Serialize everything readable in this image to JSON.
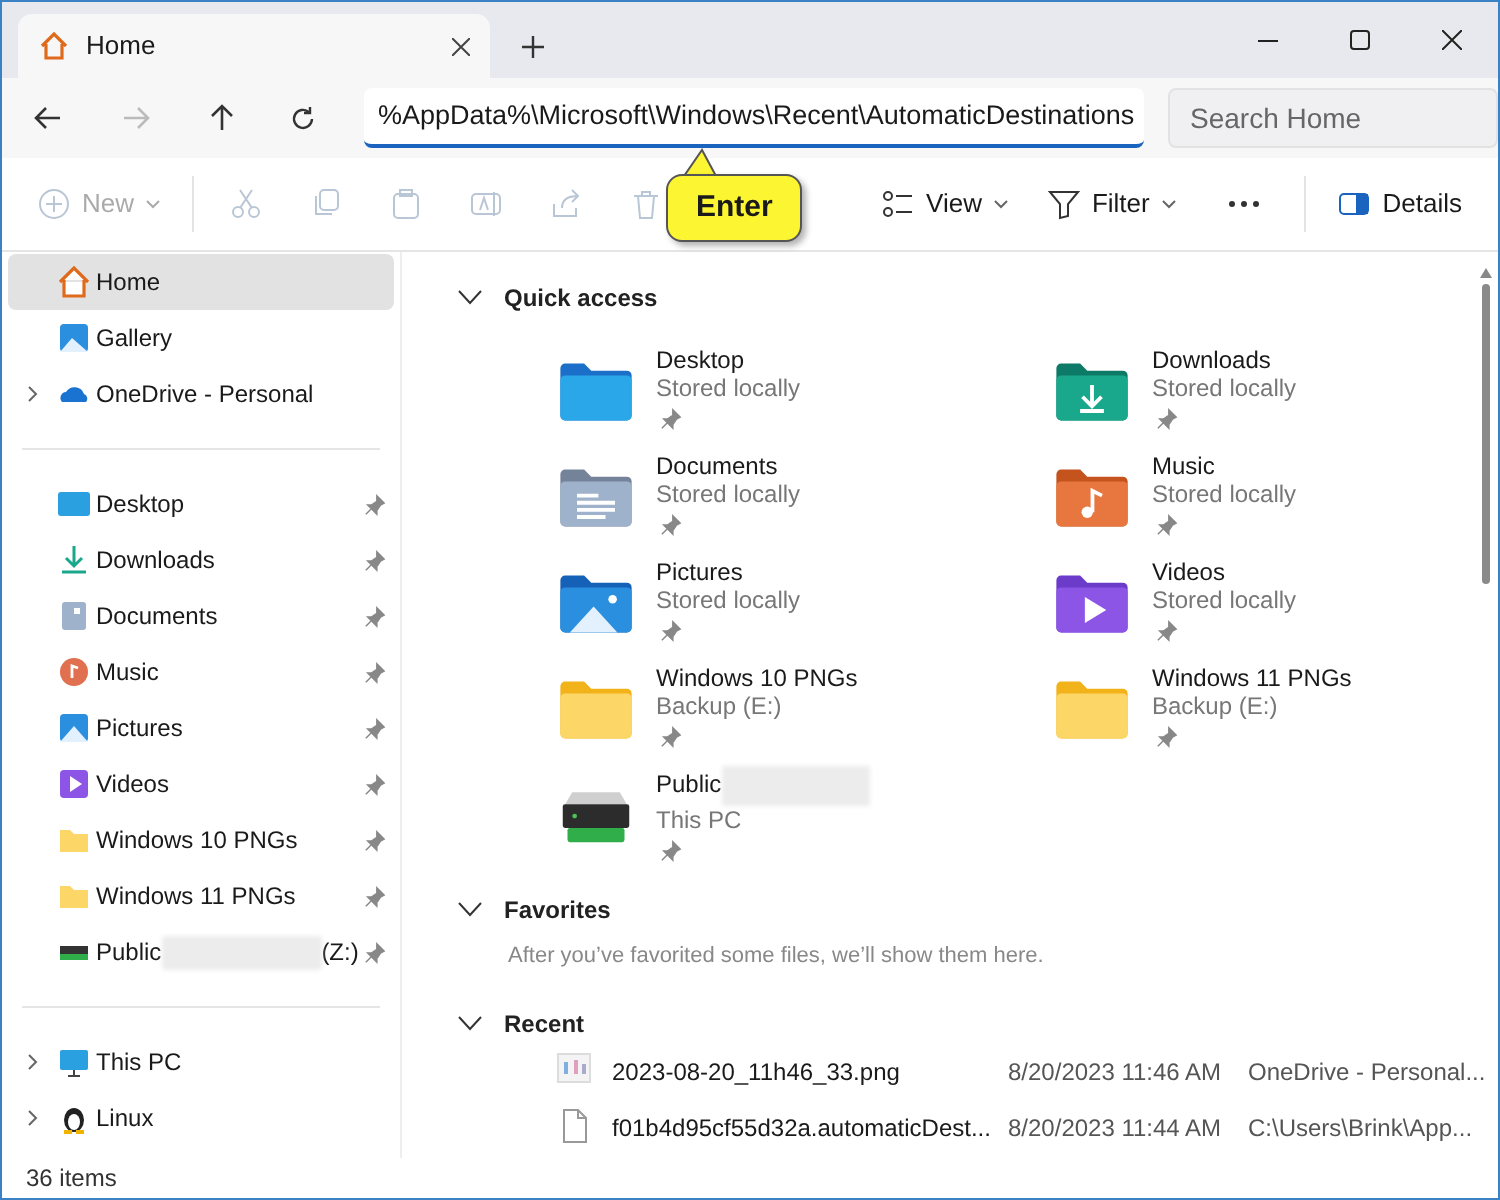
{
  "tabs": [
    {
      "label": "Home",
      "selected": true
    }
  ],
  "address": {
    "value": "%AppData%\\Microsoft\\Windows\\Recent\\AutomaticDestinations"
  },
  "search": {
    "placeholder": "Search Home"
  },
  "toolbar": [
    {
      "label": "New",
      "disabled": true
    },
    {
      "disabled": true
    },
    {
      "disabled": true
    },
    {
      "disabled": true
    },
    {
      "disabled": true
    },
    {
      "disabled": true
    },
    {
      "disabled": true
    },
    {
      "label": "View",
      "disabled": false
    },
    {
      "label": "Filter",
      "disabled": false
    },
    {
      "disabled": false
    },
    {
      "label": "Details",
      "disabled": false
    }
  ],
  "callout": {
    "text": "Enter"
  },
  "sidebar": {
    "groups": [
      {
        "items": [
          {
            "label": "Home",
            "selected": true,
            "has_children": false,
            "pinned": false
          },
          {
            "label": "Gallery",
            "selected": false,
            "has_children": false,
            "pinned": false
          },
          {
            "label": "OneDrive - Personal",
            "selected": false,
            "has_children": true,
            "pinned": false
          }
        ]
      },
      {
        "items": [
          {
            "label": "Desktop",
            "selected": false,
            "has_children": false,
            "pinned": true
          },
          {
            "label": "Downloads",
            "selected": false,
            "has_children": false,
            "pinned": true
          },
          {
            "label": "Documents",
            "selected": false,
            "has_children": false,
            "pinned": true
          },
          {
            "label": "Music",
            "selected": false,
            "has_children": false,
            "pinned": true
          },
          {
            "label": "Pictures",
            "selected": false,
            "has_children": false,
            "pinned": true
          },
          {
            "label": "Videos",
            "selected": false,
            "has_children": false,
            "pinned": true
          },
          {
            "label": "Windows 10 PNGs",
            "selected": false,
            "has_children": false,
            "pinned": true
          },
          {
            "label": "Windows 11 PNGs",
            "selected": false,
            "has_children": false,
            "pinned": true
          },
          {
            "label": "Public",
            "drive": "(Z:)",
            "selected": false,
            "has_children": false,
            "pinned": true
          }
        ]
      },
      {
        "items": [
          {
            "label": "This PC",
            "selected": false,
            "has_children": true,
            "pinned": false
          },
          {
            "label": "Linux",
            "selected": false,
            "has_children": true,
            "pinned": false
          }
        ]
      }
    ]
  },
  "quick_access": {
    "title": "Quick access",
    "expanded": true,
    "items": [
      {
        "name": "Desktop",
        "detail": "Stored locally",
        "pinned": true
      },
      {
        "name": "Downloads",
        "detail": "Stored locally",
        "pinned": true
      },
      {
        "name": "Documents",
        "detail": "Stored locally",
        "pinned": true
      },
      {
        "name": "Music",
        "detail": "Stored locally",
        "pinned": true
      },
      {
        "name": "Pictures",
        "detail": "Stored locally",
        "pinned": true
      },
      {
        "name": "Videos",
        "detail": "Stored locally",
        "pinned": true
      },
      {
        "name": "Windows 10 PNGs",
        "detail": "Backup (E:)",
        "pinned": true
      },
      {
        "name": "Windows 11 PNGs",
        "detail": "Backup (E:)",
        "pinned": true
      },
      {
        "name": "Public",
        "detail": "This PC",
        "pinned": true
      }
    ]
  },
  "favorites": {
    "title": "Favorites",
    "expanded": true,
    "message": "After you’ve favorited some files, we’ll show them here."
  },
  "recent": {
    "title": "Recent",
    "expanded": true,
    "files": [
      {
        "name": "2023-08-20_11h46_33.png",
        "date": "8/20/2023 11:46 AM",
        "location": "OneDrive - Personal..."
      },
      {
        "name": "f01b4d95cf55d32a.automaticDest...",
        "date": "8/20/2023 11:44 AM",
        "location": "C:\\Users\\Brink\\App..."
      }
    ]
  },
  "status_bar": {
    "count": "36 items"
  }
}
